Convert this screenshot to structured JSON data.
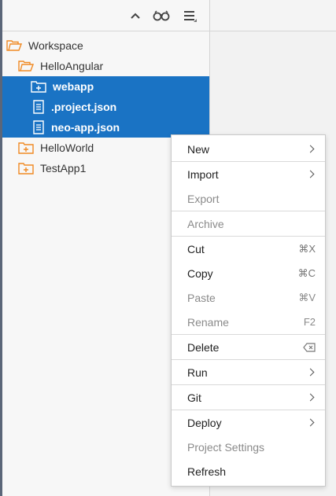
{
  "toolbar": {
    "icons": [
      "collapse-up-icon",
      "glasses-icon",
      "menu-icon"
    ]
  },
  "tree": {
    "items": [
      {
        "label": "Workspace",
        "icon": "folder-open-icon"
      },
      {
        "label": "HelloAngular",
        "icon": "folder-open-icon"
      },
      {
        "label": "webapp",
        "icon": "folder-plus-icon",
        "selected": true
      },
      {
        "label": ".project.json",
        "icon": "file-icon",
        "selected": true
      },
      {
        "label": "neo-app.json",
        "icon": "file-icon",
        "selected": true
      },
      {
        "label": "HelloWorld",
        "icon": "folder-plus-icon"
      },
      {
        "label": "TestApp1",
        "icon": "folder-plus-icon"
      }
    ]
  },
  "context_menu": {
    "new": "New",
    "import": "Import",
    "export": "Export",
    "archive": "Archive",
    "cut": "Cut",
    "cut_shortcut": "⌘X",
    "copy": "Copy",
    "copy_shortcut": "⌘C",
    "paste": "Paste",
    "paste_shortcut": "⌘V",
    "rename": "Rename",
    "rename_shortcut": "F2",
    "delete": "Delete",
    "run": "Run",
    "git": "Git",
    "deploy": "Deploy",
    "project_settings": "Project Settings",
    "refresh": "Refresh"
  },
  "colors": {
    "selection": "#1a73c4",
    "folder_orange": "#f08a24",
    "disabled_text": "#8a8a8a"
  }
}
